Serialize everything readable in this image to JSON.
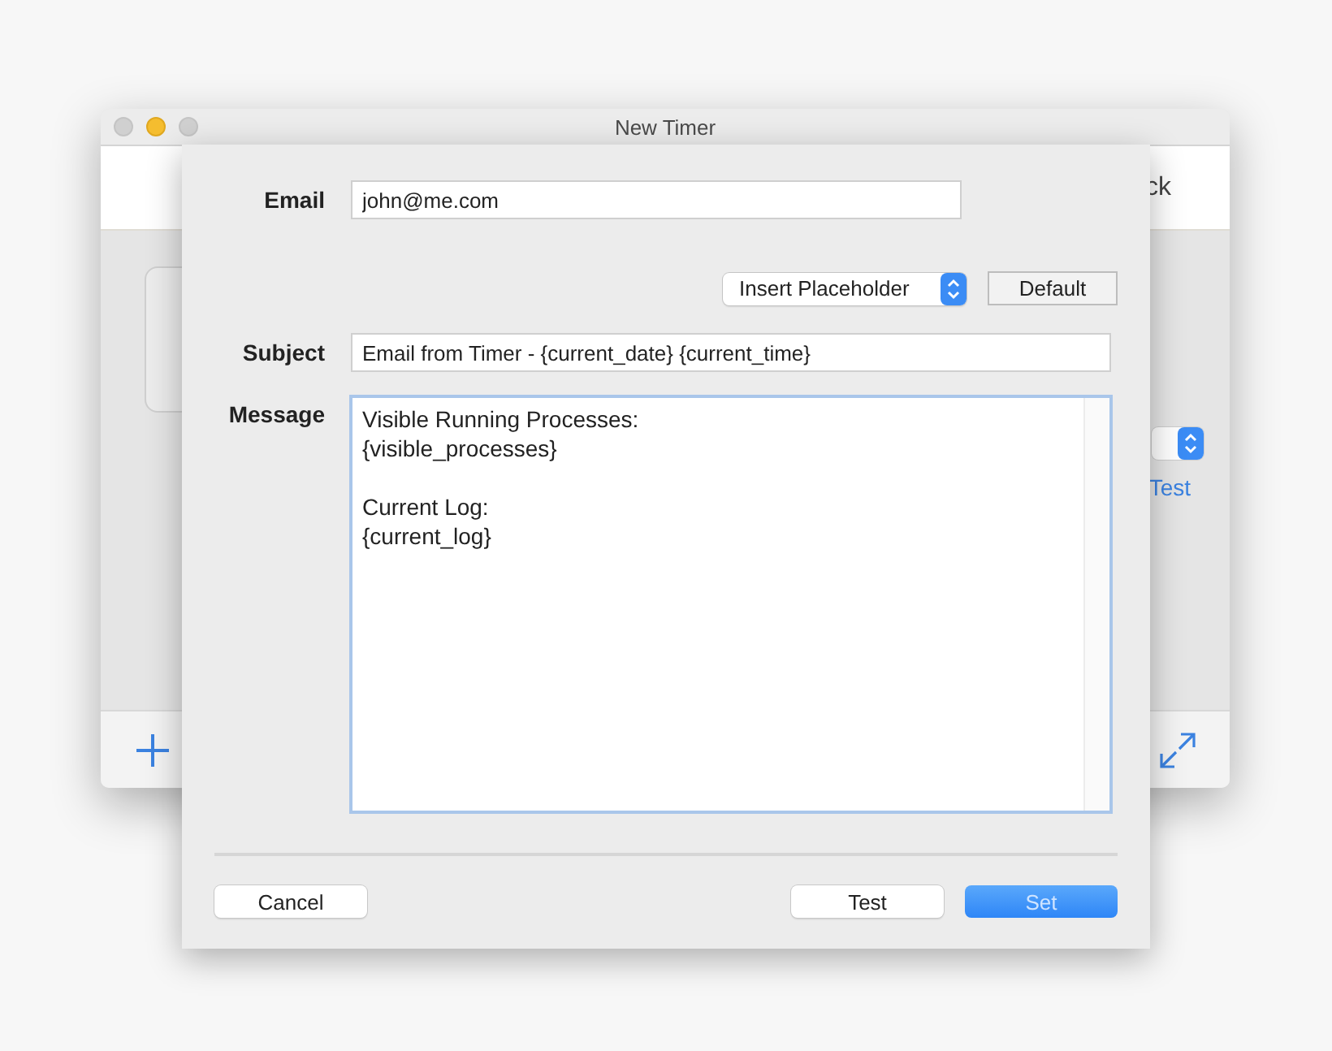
{
  "window": {
    "title": "New Timer",
    "toolbar_right_text": "ck",
    "link_partial": "Test"
  },
  "sheet": {
    "email": {
      "label": "Email",
      "value": "john@me.com"
    },
    "placeholder_popup": {
      "label": "Insert Placeholder"
    },
    "default_button": {
      "label": "Default"
    },
    "subject": {
      "label": "Subject",
      "value": "Email from Timer - {current_date} {current_time}"
    },
    "message": {
      "label": "Message",
      "value": "Visible Running Processes:\n{visible_processes}\n\nCurrent Log:\n{current_log}"
    },
    "buttons": [
      {
        "label": "Cancel",
        "kind": "normal"
      },
      {
        "label": "Test",
        "kind": "normal"
      },
      {
        "label": "Set",
        "kind": "default"
      }
    ]
  }
}
